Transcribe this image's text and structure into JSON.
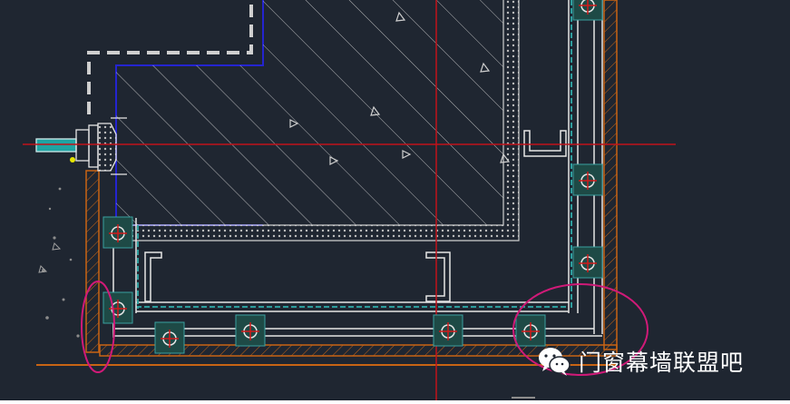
{
  "drawing": {
    "background_color": "#1f2631",
    "frame_color": "#c8c8c8",
    "centerline_color": "#c0121a",
    "concrete_outline_color": "#1818c8",
    "steel_channel_color": "#e6e6e6",
    "embed_plate_color": "#2d8c8c",
    "finish_line_color": "#c86414",
    "highlight_circle_color": "#d01a78",
    "hatch_color": "#bdbdbd"
  },
  "watermark": {
    "text": "门窗幕墙联盟吧",
    "icon": "wechat-icon"
  }
}
